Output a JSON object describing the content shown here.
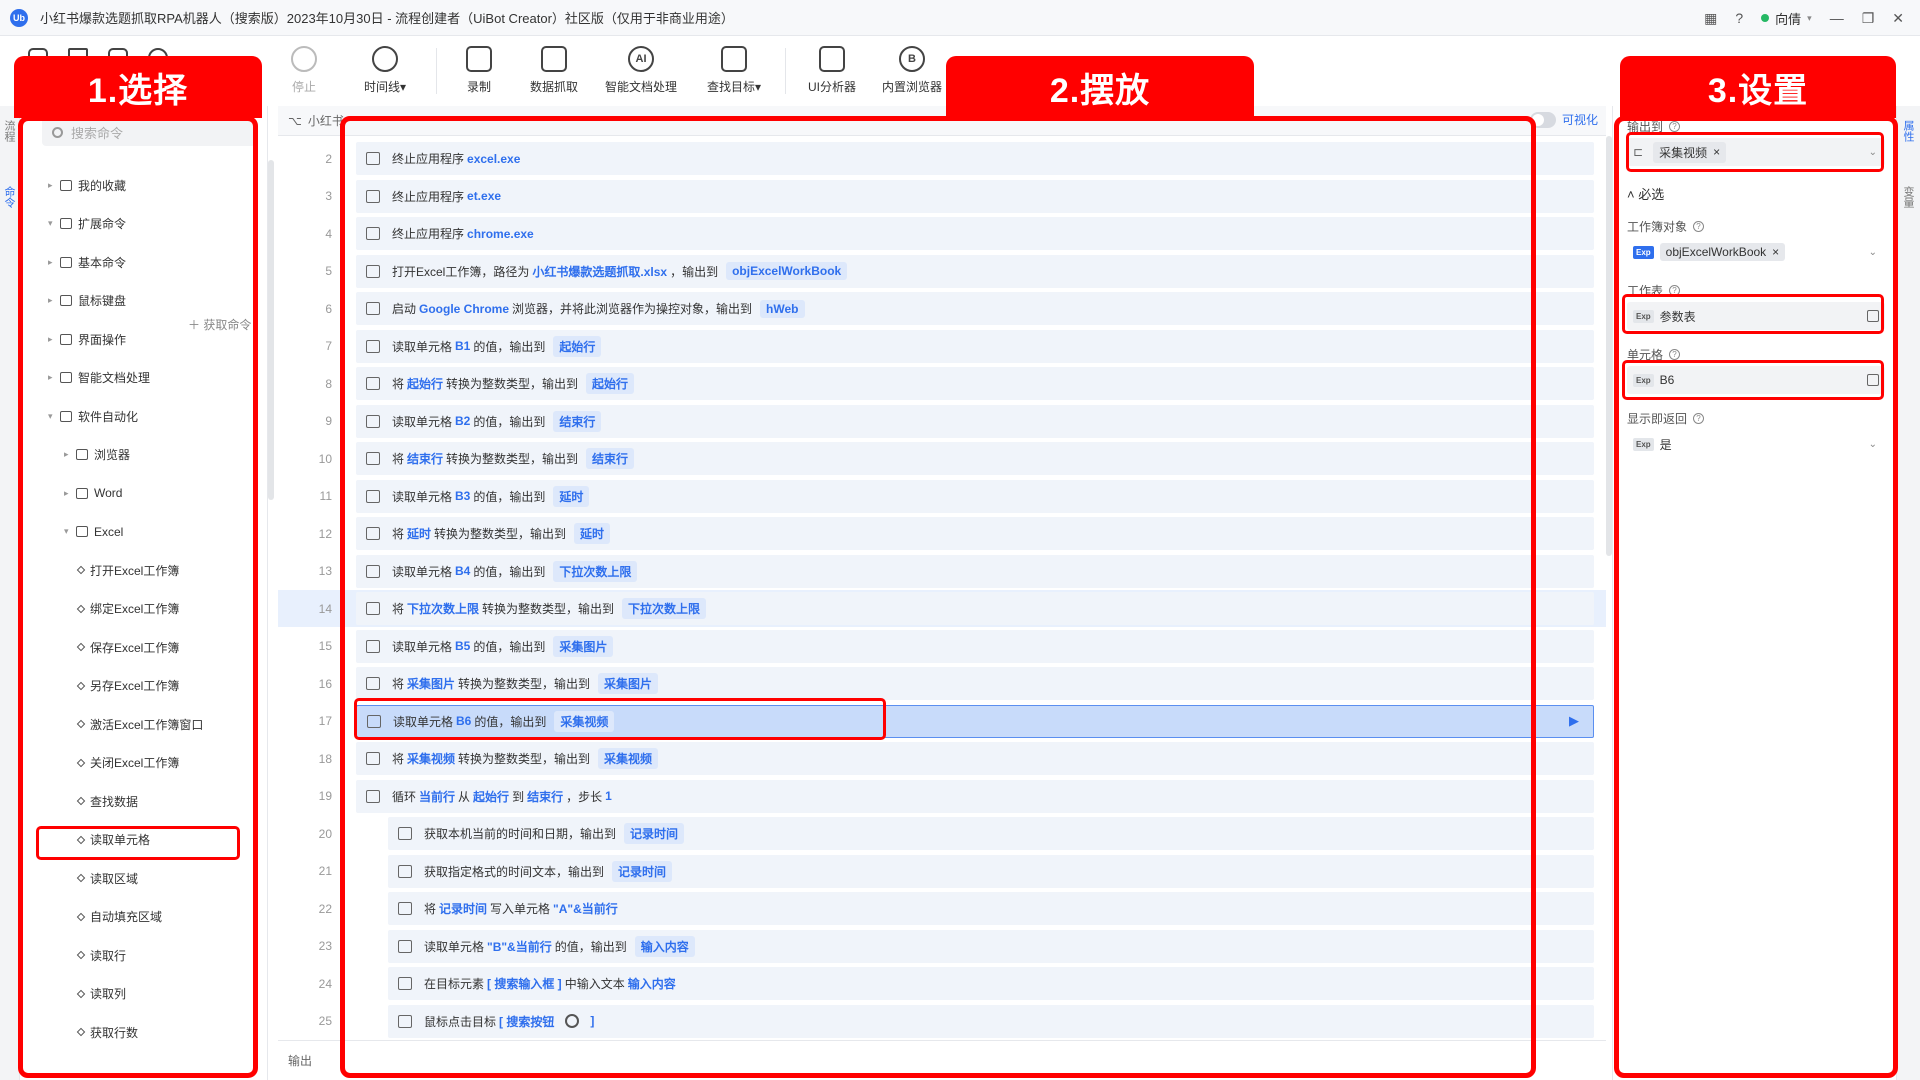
{
  "window": {
    "title": "小红书爆款选题抓取RPA机器人（搜索版）2023年10月30日 - 流程创建者（UiBot Creator）社区版（仅用于非商业用途）",
    "logo": "Ub",
    "user": "向倩"
  },
  "toolbar": {
    "buttons": [
      {
        "label": "停止",
        "icon": "stop-icon",
        "dim": true
      },
      {
        "label": "时间线▾",
        "icon": "clock-icon"
      },
      {
        "label": "录制",
        "icon": "record-icon"
      },
      {
        "label": "数据抓取",
        "icon": "data-scrape-icon"
      },
      {
        "label": "智能文档处理",
        "icon": "ai-doc-icon",
        "glyph": "AI"
      },
      {
        "label": "查找目标▾",
        "icon": "find-target-icon"
      },
      {
        "label": "UI分析器",
        "icon": "ui-analyzer-icon"
      },
      {
        "label": "内置浏览器",
        "icon": "browser-icon",
        "glyph": "B"
      }
    ]
  },
  "left_panel": {
    "search_placeholder": "搜索命令",
    "get_command": "＋ 获取命令",
    "tree": [
      {
        "label": "我的收藏",
        "level": 0,
        "caret": "▸"
      },
      {
        "label": "扩展命令",
        "level": 0,
        "caret": "▾"
      },
      {
        "label": "基本命令",
        "level": 0,
        "caret": "▸"
      },
      {
        "label": "鼠标键盘",
        "level": 0,
        "caret": "▸"
      },
      {
        "label": "界面操作",
        "level": 0,
        "caret": "▸"
      },
      {
        "label": "智能文档处理",
        "level": 0,
        "caret": "▸"
      },
      {
        "label": "软件自动化",
        "level": 0,
        "caret": "▾"
      },
      {
        "label": "浏览器",
        "level": 1,
        "caret": "▸"
      },
      {
        "label": "Word",
        "level": 1,
        "caret": "▸"
      },
      {
        "label": "Excel",
        "level": 1,
        "caret": "▾"
      },
      {
        "label": "打开Excel工作簿",
        "level": 2
      },
      {
        "label": "绑定Excel工作簿",
        "level": 2
      },
      {
        "label": "保存Excel工作簿",
        "level": 2
      },
      {
        "label": "另存Excel工作簿",
        "level": 2
      },
      {
        "label": "激活Excel工作簿窗口",
        "level": 2
      },
      {
        "label": "关闭Excel工作簿",
        "level": 2
      },
      {
        "label": "查找数据",
        "level": 2
      },
      {
        "label": "读取单元格",
        "level": 2
      },
      {
        "label": "读取区域",
        "level": 2
      },
      {
        "label": "自动填充区域",
        "level": 2
      },
      {
        "label": "读取行",
        "level": 2
      },
      {
        "label": "读取列",
        "level": 2
      },
      {
        "label": "获取行数",
        "level": 2
      }
    ]
  },
  "breadcrumb": "小红书",
  "visual_toggle": "可视化",
  "code_rows": [
    {
      "ln": "2",
      "parts": [
        [
          "t",
          "终止应用程序"
        ],
        [
          "k",
          "excel.exe"
        ]
      ]
    },
    {
      "ln": "3",
      "parts": [
        [
          "t",
          "终止应用程序"
        ],
        [
          "k",
          "et.exe"
        ]
      ]
    },
    {
      "ln": "4",
      "parts": [
        [
          "t",
          "终止应用程序"
        ],
        [
          "k",
          "chrome.exe"
        ]
      ]
    },
    {
      "ln": "5",
      "parts": [
        [
          "t",
          "打开Excel工作簿，路径为"
        ],
        [
          "k",
          "小红书爆款选题抓取.xlsx"
        ],
        [
          "t",
          "，输出到"
        ],
        [
          "v",
          "objExcelWorkBook"
        ]
      ]
    },
    {
      "ln": "6",
      "parts": [
        [
          "t",
          "启动"
        ],
        [
          "k",
          "Google Chrome"
        ],
        [
          "t",
          "浏览器，并将此浏览器作为操控对象，输出到"
        ],
        [
          "v",
          "hWeb"
        ]
      ]
    },
    {
      "ln": "7",
      "parts": [
        [
          "t",
          "读取单元格"
        ],
        [
          "k",
          "B1"
        ],
        [
          "t",
          "的值，输出到"
        ],
        [
          "v",
          "起始行"
        ]
      ]
    },
    {
      "ln": "8",
      "parts": [
        [
          "t",
          "将"
        ],
        [
          "k",
          "起始行"
        ],
        [
          "t",
          "转换为整数类型，输出到"
        ],
        [
          "v",
          "起始行"
        ]
      ]
    },
    {
      "ln": "9",
      "parts": [
        [
          "t",
          "读取单元格"
        ],
        [
          "k",
          "B2"
        ],
        [
          "t",
          "的值，输出到"
        ],
        [
          "v",
          "结束行"
        ]
      ]
    },
    {
      "ln": "10",
      "parts": [
        [
          "t",
          "将"
        ],
        [
          "k",
          "结束行"
        ],
        [
          "t",
          "转换为整数类型，输出到"
        ],
        [
          "v",
          "结束行"
        ]
      ]
    },
    {
      "ln": "11",
      "parts": [
        [
          "t",
          "读取单元格"
        ],
        [
          "k",
          "B3"
        ],
        [
          "t",
          "的值，输出到"
        ],
        [
          "v",
          "延时"
        ]
      ]
    },
    {
      "ln": "12",
      "parts": [
        [
          "t",
          "将"
        ],
        [
          "k",
          "延时"
        ],
        [
          "t",
          "转换为整数类型，输出到"
        ],
        [
          "v",
          "延时"
        ]
      ]
    },
    {
      "ln": "13",
      "parts": [
        [
          "t",
          "读取单元格"
        ],
        [
          "k",
          "B4"
        ],
        [
          "t",
          "的值，输出到"
        ],
        [
          "v",
          "下拉次数上限"
        ]
      ]
    },
    {
      "ln": "14",
      "parts": [
        [
          "t",
          "将"
        ],
        [
          "k",
          "下拉次数上限"
        ],
        [
          "t",
          "转换为整数类型，输出到"
        ],
        [
          "v",
          "下拉次数上限"
        ]
      ],
      "hl": true
    },
    {
      "ln": "15",
      "parts": [
        [
          "t",
          "读取单元格"
        ],
        [
          "k",
          "B5"
        ],
        [
          "t",
          "的值，输出到"
        ],
        [
          "v",
          "采集图片"
        ]
      ]
    },
    {
      "ln": "16",
      "parts": [
        [
          "t",
          "将"
        ],
        [
          "k",
          "采集图片"
        ],
        [
          "t",
          "转换为整数类型，输出到"
        ],
        [
          "v",
          "采集图片"
        ]
      ]
    },
    {
      "ln": "17",
      "parts": [
        [
          "t",
          "读取单元格"
        ],
        [
          "k",
          "B6"
        ],
        [
          "t",
          "的值，输出到"
        ],
        [
          "v",
          "采集视频"
        ]
      ],
      "sel": true
    },
    {
      "ln": "18",
      "parts": [
        [
          "t",
          "将"
        ],
        [
          "k",
          "采集视频"
        ],
        [
          "t",
          "转换为整数类型，输出到"
        ],
        [
          "v",
          "采集视频"
        ]
      ]
    },
    {
      "ln": "19",
      "parts": [
        [
          "t",
          "循环"
        ],
        [
          "k",
          "当前行"
        ],
        [
          "t",
          "从"
        ],
        [
          "k",
          "起始行"
        ],
        [
          "t",
          "到"
        ],
        [
          "k",
          "结束行"
        ],
        [
          "t",
          "，步长"
        ],
        [
          "k",
          "1"
        ]
      ]
    },
    {
      "ln": "20",
      "l2": true,
      "parts": [
        [
          "t",
          "获取本机当前的时间和日期，输出到"
        ],
        [
          "v",
          "记录时间"
        ]
      ]
    },
    {
      "ln": "21",
      "l2": true,
      "parts": [
        [
          "t",
          "获取指定格式的时间文本，输出到"
        ],
        [
          "v",
          "记录时间"
        ]
      ]
    },
    {
      "ln": "22",
      "l2": true,
      "parts": [
        [
          "t",
          "将"
        ],
        [
          "k",
          "记录时间"
        ],
        [
          "t",
          "写入单元格"
        ],
        [
          "k",
          "\"A\"&当前行"
        ]
      ]
    },
    {
      "ln": "23",
      "l2": true,
      "parts": [
        [
          "t",
          "读取单元格"
        ],
        [
          "k",
          "\"B\"&当前行"
        ],
        [
          "t",
          "的值，输出到"
        ],
        [
          "v",
          "输入内容"
        ]
      ]
    },
    {
      "ln": "24",
      "l2": true,
      "parts": [
        [
          "t",
          "在目标元素"
        ],
        [
          "k",
          "[ 搜索输入框 ]"
        ],
        [
          "t",
          "中输入文本"
        ],
        [
          "k",
          "输入内容"
        ]
      ]
    },
    {
      "ln": "25",
      "l2": true,
      "parts": [
        [
          "t",
          "鼠标点击目标"
        ],
        [
          "k",
          "[ 搜索按钮"
        ],
        [
          "m",
          ""
        ],
        [
          "k",
          "]"
        ]
      ]
    }
  ],
  "bottom_label": "输出",
  "right_panel": {
    "output_label": "输出到",
    "output_value": "采集视频",
    "required_section": "˄ 必选",
    "workbook_label": "工作簿对象",
    "workbook_value": "objExcelWorkBook",
    "sheet_label": "工作表",
    "sheet_value": "参数表",
    "cell_label": "单元格",
    "cell_value": "B6",
    "return_label": "显示即返回",
    "return_value": "是",
    "exp": "Exp"
  },
  "sidebar_tabs": {
    "left": [
      "流程",
      "命令"
    ],
    "right": [
      "属性",
      "变量"
    ]
  },
  "annotations": {
    "step1": "1.选择",
    "step2": "2.摆放",
    "step3": "3.设置"
  },
  "colors": {
    "accent": "#2f6fed",
    "annotation": "#ff0000",
    "highlight_row": "#e8f0fd",
    "selected_row": "#c8dbfa"
  }
}
